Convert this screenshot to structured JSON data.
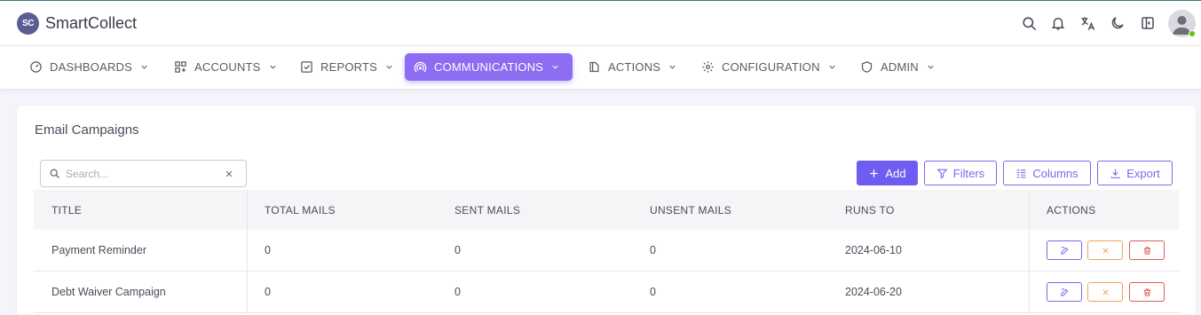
{
  "app": {
    "logo_text": "SC",
    "name": "SmartCollect"
  },
  "header": {
    "icons": [
      "search-icon",
      "bell-icon",
      "translate-icon",
      "moon-icon",
      "sidebar-toggle-icon"
    ],
    "avatar": {
      "status_color": "#56ca00"
    }
  },
  "nav": {
    "items": [
      {
        "label": "DASHBOARDS",
        "icon": "dashboard-icon"
      },
      {
        "label": "ACCOUNTS",
        "icon": "accounts-icon"
      },
      {
        "label": "REPORTS",
        "icon": "reports-icon"
      },
      {
        "label": "COMMUNICATIONS",
        "icon": "communications-icon",
        "active": true
      },
      {
        "label": "ACTIONS",
        "icon": "actions-icon"
      },
      {
        "label": "CONFIGURATION",
        "icon": "gear-icon"
      },
      {
        "label": "ADMIN",
        "icon": "shield-icon"
      }
    ],
    "active_color": "#8c6cf0"
  },
  "page": {
    "title": "Email Campaigns",
    "search": {
      "placeholder": "Search...",
      "value": ""
    },
    "toolbar": {
      "add_label": "Add",
      "filters_label": "Filters",
      "columns_label": "Columns",
      "export_label": "Export"
    }
  },
  "table": {
    "columns": [
      "TITLE",
      "TOTAL MAILS",
      "SENT MAILS",
      "UNSENT MAILS",
      "RUNS TO",
      "ACTIONS"
    ],
    "rows": [
      {
        "title": "Payment Reminder",
        "total": "0",
        "sent": "0",
        "unsent": "0",
        "runs_to": "2024-06-10"
      },
      {
        "title": "Debt Waiver Campaign",
        "total": "0",
        "sent": "0",
        "unsent": "0",
        "runs_to": "2024-06-20"
      }
    ],
    "row_actions": [
      "edit-icon",
      "cancel-icon",
      "delete-icon"
    ]
  },
  "colors": {
    "primary": "#6f5cf0",
    "edit": "#7c68e8",
    "cancel": "#f0a35a",
    "delete": "#e35a5a"
  }
}
